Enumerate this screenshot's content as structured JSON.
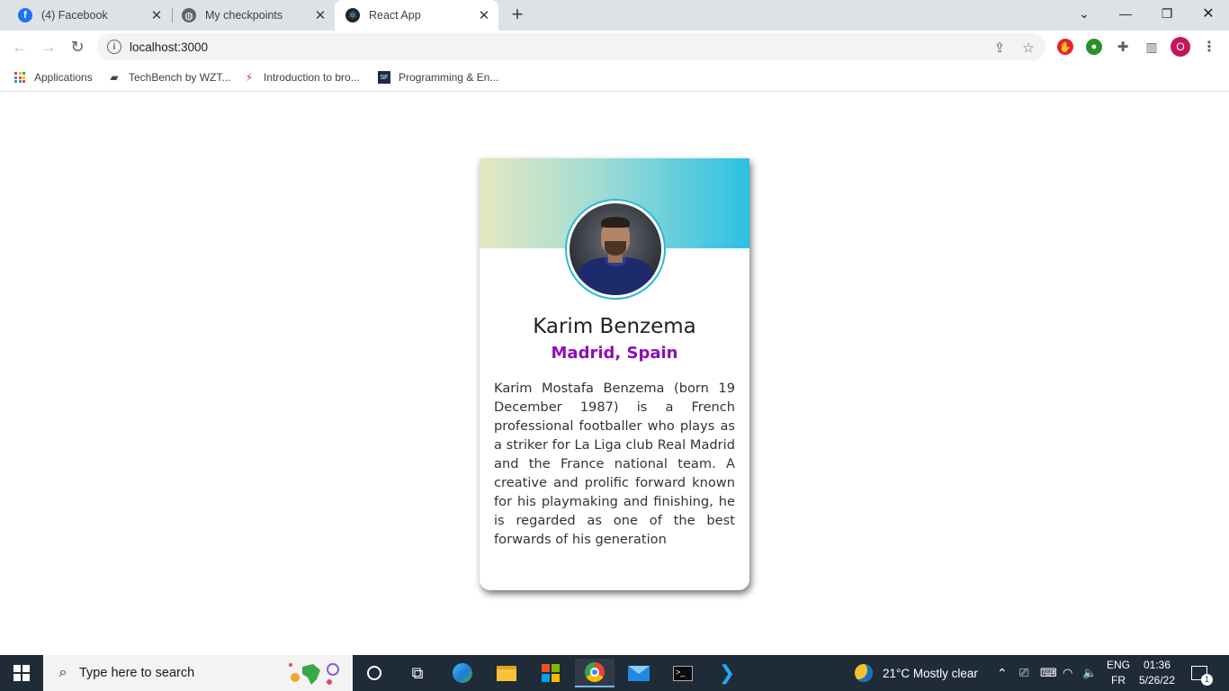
{
  "browser": {
    "tabs": [
      {
        "title": "(4) Facebook",
        "favicon": "facebook-icon",
        "active": false
      },
      {
        "title": "My checkpoints",
        "favicon": "globe-icon",
        "active": false
      },
      {
        "title": "React App",
        "favicon": "react-icon",
        "active": true
      }
    ],
    "url": "localhost:3000",
    "profile_initial": "O",
    "bookmarks": [
      {
        "label": "Applications",
        "icon": "apps-grid-icon"
      },
      {
        "label": "TechBench by WZT...",
        "icon": "techbench-icon"
      },
      {
        "label": "Introduction to bro...",
        "icon": "tower-icon"
      },
      {
        "label": "Programming & En...",
        "icon": "sf-icon"
      }
    ]
  },
  "card": {
    "name": "Karim Benzema",
    "location": "Madrid, Spain",
    "bio": "Karim Mostafa Benzema (born 19 December 1987) is a French professional footballer who plays as a striker for La Liga club Real Madrid and the France national team. A creative and prolific forward known for his playmaking and finishing, he is regarded as one of the best forwards of his generation",
    "accent_color": "#8c0fb3",
    "banner_colors": [
      "#e6e8c1",
      "#2cc0e4"
    ]
  },
  "taskbar": {
    "search_placeholder": "Type here to search",
    "weather": "21°C  Mostly clear",
    "language": "ENG",
    "layout": "FR",
    "time": "01:36",
    "date": "5/26/22",
    "notification_count": "1"
  }
}
